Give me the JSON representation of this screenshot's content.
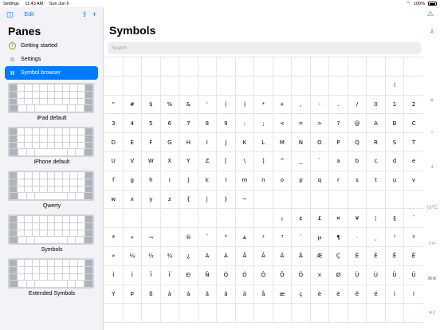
{
  "status_bar": {
    "app": "Settings",
    "time": "11:43 AM",
    "date": "Sun Jun 6",
    "battery": "100%"
  },
  "sidebar": {
    "edit_label": "Edit",
    "title": "Panes",
    "items": [
      {
        "label": "Getting started",
        "icon": "info-icon"
      },
      {
        "label": "Settings",
        "icon": "gear-icon"
      },
      {
        "label": "Symbol browser",
        "icon": "command-icon",
        "active": true
      }
    ],
    "keyboards": [
      {
        "label": "iPad default"
      },
      {
        "label": "iPhone default"
      },
      {
        "label": "Qwerty"
      },
      {
        "label": "Symbols"
      },
      {
        "label": "Extended Symbols"
      }
    ]
  },
  "main": {
    "title": "Symbols",
    "search_placeholder": "Search",
    "rows": [
      [
        "",
        "",
        "",
        "",
        "",
        "",
        "",
        "",
        "",
        "",
        "",
        "",
        "",
        "",
        "",
        "",
        ""
      ],
      [
        "",
        "",
        "",
        "",
        "",
        "",
        "",
        "",
        "",
        "",
        "",
        "",
        "",
        "",
        "",
        "!"
      ],
      [
        "\"",
        "#",
        "$",
        "%",
        "&",
        "'",
        "(",
        ")",
        "*",
        "+",
        ",",
        "-",
        ".",
        "/",
        "0",
        "1",
        "2"
      ],
      [
        "3",
        "4",
        "5",
        "6",
        "7",
        "8",
        "9",
        ":",
        ";",
        "<",
        "=",
        ">",
        "?",
        "@",
        "A",
        "B",
        "C"
      ],
      [
        "D",
        "E",
        "F",
        "G",
        "H",
        "I",
        "J",
        "K",
        "L",
        "M",
        "N",
        "O",
        "P",
        "Q",
        "R",
        "S",
        "T"
      ],
      [
        "U",
        "V",
        "W",
        "X",
        "Y",
        "Z",
        "[",
        "\\",
        "]",
        "^",
        "_",
        "`",
        "a",
        "b",
        "c",
        "d",
        "e"
      ],
      [
        "f",
        "g",
        "h",
        "i",
        "j",
        "k",
        "l",
        "m",
        "n",
        "o",
        "p",
        "q",
        "r",
        "s",
        "t",
        "u",
        "v"
      ],
      [
        "w",
        "x",
        "y",
        "z",
        "{",
        "|",
        "}",
        "~",
        "",
        "",
        "",
        "",
        "",
        "",
        "",
        "",
        ""
      ],
      [
        "",
        "",
        "",
        "",
        "",
        "",
        "",
        "",
        "",
        "¡",
        "¢",
        "£",
        "¤",
        "¥",
        "¦",
        "§",
        "¨",
        "©"
      ],
      [
        "ª",
        "«",
        "¬",
        "",
        "®",
        "¯",
        "°",
        "±",
        "²",
        "³",
        "´",
        "µ",
        "¶",
        "·",
        "¸",
        "¹",
        "º"
      ],
      [
        "»",
        "¼",
        "½",
        "¾",
        "¿",
        "À",
        "Á",
        "Â",
        "Ã",
        "Ä",
        "Å",
        "Æ",
        "Ç",
        "È",
        "É",
        "Ê",
        "Ë"
      ],
      [
        "Ì",
        "Í",
        "Î",
        "Ï",
        "Ð",
        "Ñ",
        "Ò",
        "Ó",
        "Ô",
        "Õ",
        "Ö",
        "×",
        "Ø",
        "Ù",
        "Ú",
        "Û",
        "Ü"
      ],
      [
        "Ý",
        "Þ",
        "ß",
        "à",
        "á",
        "â",
        "ã",
        "ä",
        "å",
        "æ",
        "ç",
        "è",
        "é",
        "ê",
        "ë",
        "ì",
        "í"
      ],
      [
        "",
        "",
        "",
        "",
        "",
        "",
        "",
        "",
        "",
        "",
        "",
        "",
        "",
        "",
        "",
        "",
        ""
      ]
    ],
    "index": [
      "Ā",
      "e",
      "ᵃ",
      "↓",
      "⅓°C",
      "√∞",
      "⌘⊗",
      "✈♪"
    ],
    "accent_color": "#af52de"
  }
}
